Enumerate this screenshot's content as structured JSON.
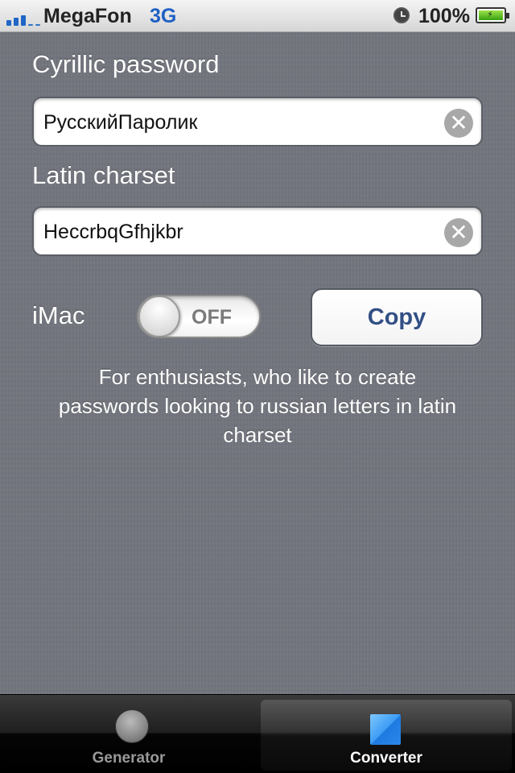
{
  "status_bar": {
    "carrier": "MegaFon",
    "network": "3G",
    "battery_percent": "100%",
    "icons": [
      "signal-icon",
      "alarm-clock-icon",
      "battery-charging-icon"
    ]
  },
  "converter": {
    "cyrillic_label": "Cyrillic password",
    "cyrillic_value": "РусскийПаролик",
    "latin_label": "Latin charset",
    "latin_value": "HeccrbqGfhjkbr",
    "imac_label": "iMac",
    "toggle_state": "OFF",
    "copy_label": "Copy",
    "description": "For enthusiasts, who like to create passwords looking to russian letters in latin charset"
  },
  "tab_bar": {
    "tabs": [
      {
        "label": "Generator",
        "icon": "circle-icon",
        "active": false
      },
      {
        "label": "Converter",
        "icon": "blue-square-icon",
        "active": true
      }
    ]
  },
  "colors": {
    "background": "#72757d",
    "accent": "#324f85",
    "network_blue": "#1f5fc4"
  }
}
